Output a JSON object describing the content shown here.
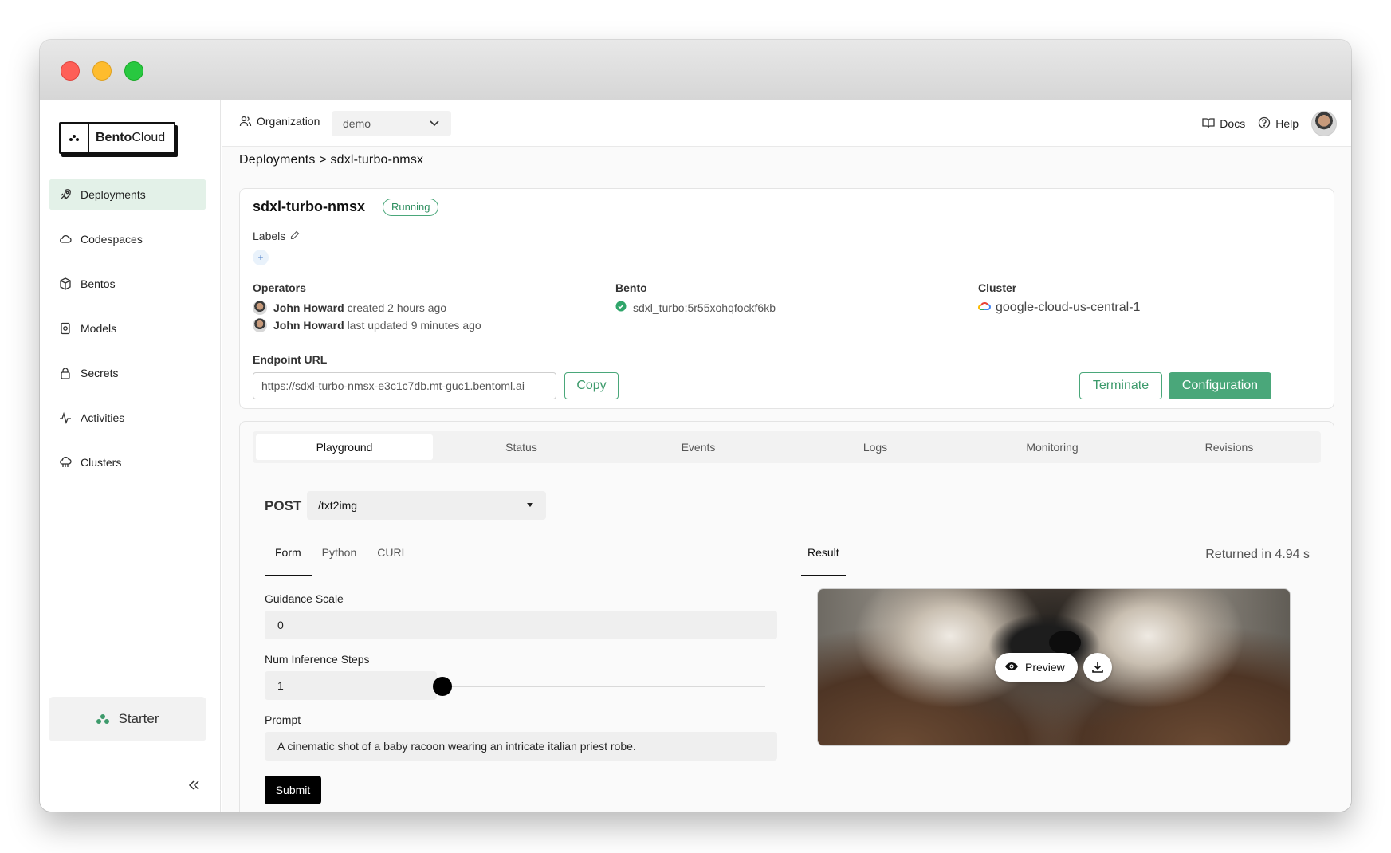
{
  "brand": {
    "name_bold": "Bento",
    "name_regular": "Cloud"
  },
  "sidebar": {
    "items": [
      {
        "label": "Deployments",
        "icon": "rocket-icon",
        "active": true
      },
      {
        "label": "Codespaces",
        "icon": "cloud-icon"
      },
      {
        "label": "Bentos",
        "icon": "box-icon"
      },
      {
        "label": "Models",
        "icon": "model-icon"
      },
      {
        "label": "Secrets",
        "icon": "lock-icon"
      },
      {
        "label": "Activities",
        "icon": "activity-icon"
      },
      {
        "label": "Clusters",
        "icon": "cluster-icon"
      }
    ],
    "plan": "Starter"
  },
  "topbar": {
    "org_label": "Organization",
    "org_value": "demo",
    "docs": "Docs",
    "help": "Help"
  },
  "breadcrumb": "Deployments > sdxl-turbo-nmsx",
  "deployment": {
    "name": "sdxl-turbo-nmsx",
    "status": "Running",
    "labels_title": "Labels",
    "add_label": "+",
    "operators_title": "Operators",
    "operators": [
      {
        "user": "John Howard",
        "action": "created 2 hours ago"
      },
      {
        "user": "John Howard",
        "action": "last updated 9 minutes ago"
      }
    ],
    "bento_title": "Bento",
    "bento": "sdxl_turbo:5r55xohqfockf6kb",
    "cluster_title": "Cluster",
    "cluster": "google-cloud-us-central-1",
    "endpoint_title": "Endpoint URL",
    "endpoint_url": "https://sdxl-turbo-nmsx-e3c1c7db.mt-guc1.bentoml.ai",
    "copy": "Copy",
    "terminate": "Terminate",
    "configuration": "Configuration",
    "colors": {
      "accent": "#4aa77a"
    }
  },
  "playground": {
    "tabs": [
      "Playground",
      "Status",
      "Events",
      "Logs",
      "Monitoring",
      "Revisions"
    ],
    "active_tab": "Playground",
    "method": "POST",
    "route": "/txt2img",
    "subtabs": [
      "Form",
      "Python",
      "CURL"
    ],
    "fields": {
      "guidance_label": "Guidance Scale",
      "guidance_value": "0",
      "steps_label": "Num Inference Steps",
      "steps_value": "1",
      "prompt_label": "Prompt",
      "prompt_value": "A cinematic shot of a baby racoon wearing an intricate italian priest robe."
    },
    "submit": "Submit",
    "result_tab": "Result",
    "returned": "Returned in 4.94 s",
    "preview": "Preview"
  }
}
